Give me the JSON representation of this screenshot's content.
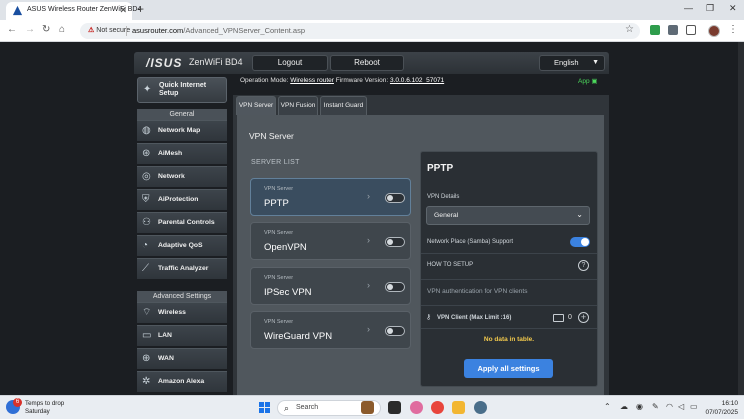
{
  "browser": {
    "tab_title": "ASUS Wireless Router ZenWiFi BD4",
    "tab_close": "✕",
    "new_tab": "+",
    "security_label": "Not secure",
    "url_host": "asusrouter.com",
    "url_path": "/Advanced_VPNServer_Content.asp",
    "win_min": "—",
    "win_max": "❐",
    "win_close": "✕"
  },
  "header": {
    "brand": "/ISUS",
    "model": "ZenWiFi BD4",
    "logout": "Logout",
    "reboot": "Reboot",
    "language": "English"
  },
  "status": {
    "operation_mode_label": "Operation Mode:",
    "operation_mode": "Wireless router",
    "firmware_label": "Firmware Version:",
    "firmware": "3.0.0.6.102_57071",
    "app_label": "App"
  },
  "sidebar": {
    "qis_label": "Quick Internet Setup",
    "general_heading": "General",
    "general_items": [
      {
        "label": "Network Map"
      },
      {
        "label": "AiMesh"
      },
      {
        "label": "Network"
      },
      {
        "label": "AiProtection"
      },
      {
        "label": "Parental Controls"
      },
      {
        "label": "Adaptive QoS"
      },
      {
        "label": "Traffic Analyzer"
      }
    ],
    "advanced_heading": "Advanced Settings",
    "advanced_items": [
      {
        "label": "Wireless"
      },
      {
        "label": "LAN"
      },
      {
        "label": "WAN"
      },
      {
        "label": "Amazon Alexa"
      }
    ]
  },
  "tabs": [
    {
      "label": "VPN Server",
      "active": true
    },
    {
      "label": "VPN Fusion",
      "active": false
    },
    {
      "label": "Instant Guard",
      "active": false
    }
  ],
  "main": {
    "title": "VPN Server",
    "server_list_label": "SERVER LIST",
    "servers": [
      {
        "caption": "VPN Server",
        "name": "PPTP",
        "enabled": false,
        "selected": true
      },
      {
        "caption": "VPN Server",
        "name": "OpenVPN",
        "enabled": false,
        "selected": false
      },
      {
        "caption": "VPN Server",
        "name": "IPSec VPN",
        "enabled": false,
        "selected": false
      },
      {
        "caption": "VPN Server",
        "name": "WireGuard VPN",
        "enabled": false,
        "selected": false
      }
    ]
  },
  "detail": {
    "title": "PPTP",
    "vpn_details_label": "VPN Details",
    "vpn_details_value": "General",
    "samba_label": "Network Place (Samba) Support",
    "samba_enabled": true,
    "how_to_setup": "HOW TO SETUP",
    "auth_text": "VPN authentication for VPN clients",
    "client_label": "VPN Client (Max Limit :16)",
    "client_count": "0",
    "no_data": "No data in table.",
    "apply_label": "Apply all settings"
  },
  "taskbar": {
    "weather_badge": "6",
    "weather_line1": "Temps to drop",
    "weather_line2": "Saturday",
    "search_placeholder": "Search",
    "time": "16:10",
    "date": "07/07/2025"
  },
  "colors": {
    "accent": "#3b82e0",
    "warning_text": "#f2c94c",
    "app_green": "#4cd95c"
  }
}
